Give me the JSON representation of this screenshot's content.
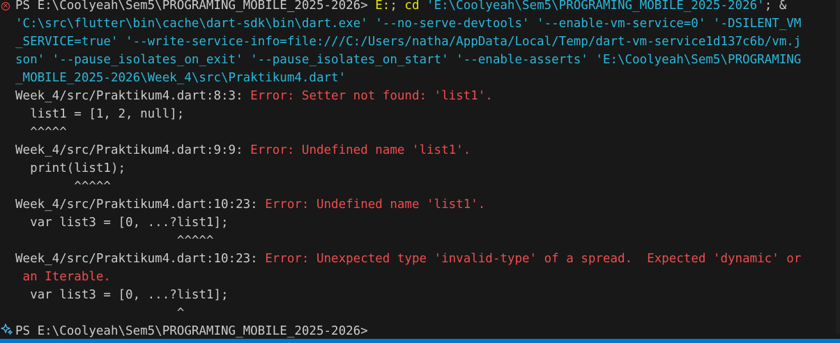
{
  "terminal": {
    "command": {
      "prompt": "PS E:\\Coolyeah\\Sem5\\PROGRAMING_MOBILE_2025-2026> ",
      "cmd_drive": "E:",
      "cmd_sep1": "; ",
      "cmd_cd": "cd",
      "cmd_path": " 'E:\\Coolyeah\\Sem5\\PROGRAMING_MOBILE_2025-2026'",
      "cmd_sep2": "; &",
      "line2": "'C:\\src\\flutter\\bin\\cache\\dart-sdk\\bin\\dart.exe' '--no-serve-devtools' '--enable-vm-service=0' '-DSILENT_VM",
      "line3": "_SERVICE=true' '--write-service-info=file:///C:/Users/natha/AppData/Local/Temp/dart-vm-service1d137c6b/vm.j",
      "line4": "son' '--pause_isolates_on_exit' '--pause_isolates_on_start' '--enable-asserts' 'E:\\Coolyeah\\Sem5\\PROGRAMING",
      "line5": "_MOBILE_2025-2026\\Week_4\\src\\Praktikum4.dart'"
    },
    "errors": [
      {
        "location": "Week_4/src/Praktikum4.dart:8:3: ",
        "message": "Error: Setter not found: 'list1'.",
        "code": "  list1 = [1, 2, null];",
        "caret": "  ^^^^^"
      },
      {
        "location": "Week_4/src/Praktikum4.dart:9:9: ",
        "message": "Error: Undefined name 'list1'.",
        "code": "  print(list1);",
        "caret": "        ^^^^^"
      },
      {
        "location": "Week_4/src/Praktikum4.dart:10:23: ",
        "message": "Error: Undefined name 'list1'.",
        "code": "  var list3 = [0, ...?list1];",
        "caret": "                      ^^^^^"
      },
      {
        "location": "Week_4/src/Praktikum4.dart:10:23: ",
        "message": "Error: Unexpected type 'invalid-type' of a spread.  Expected 'dynamic' or",
        "message_cont": " an Iterable.",
        "code": "  var list3 = [0, ...?list1];",
        "caret": "                      ^"
      }
    ],
    "final_prompt": "PS E:\\Coolyeah\\Sem5\\PROGRAMING_MOBILE_2025-2026>"
  },
  "icons": {
    "error": "error-circle-icon",
    "prompt_marker": "sparkle-icon"
  },
  "colors": {
    "background": "#181818",
    "error_red": "#f14c4c",
    "string_cyan": "#29b8db",
    "command_yellow": "#e5e510",
    "status_bar": "#0078d4"
  }
}
